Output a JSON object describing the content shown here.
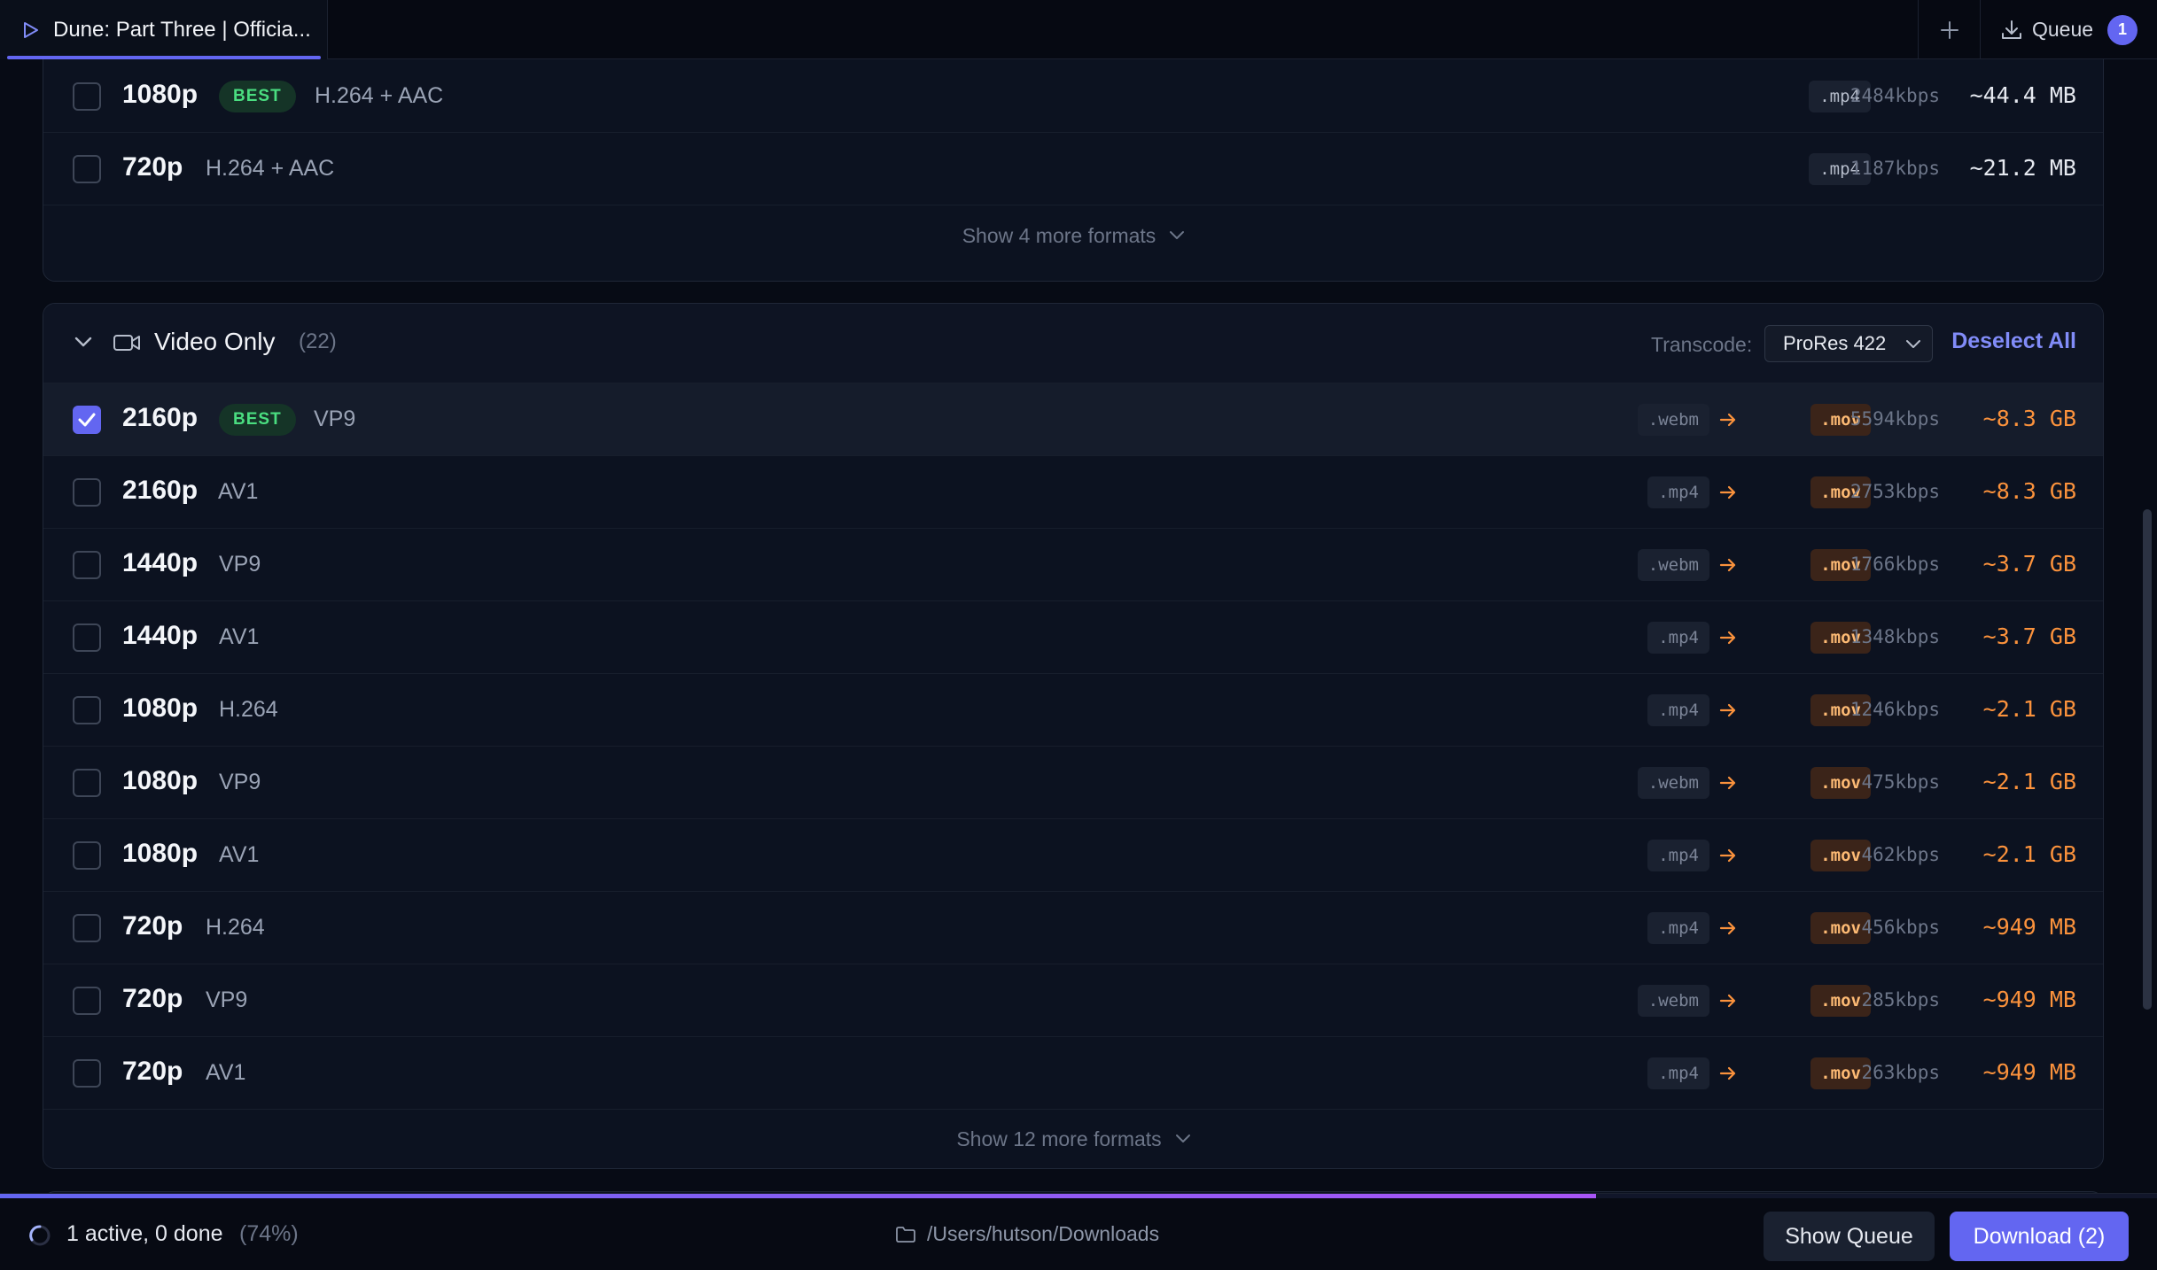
{
  "tab": {
    "title": "Dune: Part Three | Officia..."
  },
  "topbar": {
    "queue_label": "Queue",
    "queue_count": "1"
  },
  "top_group": {
    "rows": [
      {
        "res": "1080p",
        "badge": "BEST",
        "codec": "H.264 + AAC",
        "ext": ".mp4",
        "kbps": "2484kbps",
        "size": "~44.4 MB"
      },
      {
        "res": "720p",
        "badge": "",
        "codec": "H.264 + AAC",
        "ext": ".mp4",
        "kbps": "1187kbps",
        "size": "~21.2 MB"
      }
    ],
    "more_label": "Show 4 more formats"
  },
  "video_only": {
    "title": "Video Only",
    "count": "(22)",
    "transcode_label": "Transcode:",
    "transcode_value": "ProRes 422",
    "deselect_label": "Deselect All",
    "rows": [
      {
        "res": "2160p",
        "badge": "BEST",
        "codec": "VP9",
        "src": ".webm",
        "dst": ".mov",
        "kbps": "5594kbps",
        "size": "~8.3 GB",
        "checked": true
      },
      {
        "res": "2160p",
        "badge": "",
        "codec": "AV1",
        "src": ".mp4",
        "dst": ".mov",
        "kbps": "2753kbps",
        "size": "~8.3 GB",
        "checked": false
      },
      {
        "res": "1440p",
        "badge": "",
        "codec": "VP9",
        "src": ".webm",
        "dst": ".mov",
        "kbps": "1766kbps",
        "size": "~3.7 GB",
        "checked": false
      },
      {
        "res": "1440p",
        "badge": "",
        "codec": "AV1",
        "src": ".mp4",
        "dst": ".mov",
        "kbps": "1348kbps",
        "size": "~3.7 GB",
        "checked": false
      },
      {
        "res": "1080p",
        "badge": "",
        "codec": "H.264",
        "src": ".mp4",
        "dst": ".mov",
        "kbps": "1246kbps",
        "size": "~2.1 GB",
        "checked": false
      },
      {
        "res": "1080p",
        "badge": "",
        "codec": "VP9",
        "src": ".webm",
        "dst": ".mov",
        "kbps": "475kbps",
        "size": "~2.1 GB",
        "checked": false
      },
      {
        "res": "1080p",
        "badge": "",
        "codec": "AV1",
        "src": ".mp4",
        "dst": ".mov",
        "kbps": "462kbps",
        "size": "~2.1 GB",
        "checked": false
      },
      {
        "res": "720p",
        "badge": "",
        "codec": "H.264",
        "src": ".mp4",
        "dst": ".mov",
        "kbps": "456kbps",
        "size": "~949 MB",
        "checked": false
      },
      {
        "res": "720p",
        "badge": "",
        "codec": "VP9",
        "src": ".webm",
        "dst": ".mov",
        "kbps": "285kbps",
        "size": "~949 MB",
        "checked": false
      },
      {
        "res": "720p",
        "badge": "",
        "codec": "AV1",
        "src": ".mp4",
        "dst": ".mov",
        "kbps": "263kbps",
        "size": "~949 MB",
        "checked": false
      }
    ],
    "more_label": "Show 12 more formats"
  },
  "bottombar": {
    "status": "1 active, 0 done",
    "percent": "(74%)",
    "progress": 0.74,
    "path": "/Users/hutson/Downloads",
    "show_queue_label": "Show Queue",
    "download_label": "Download (2)"
  },
  "colors": {
    "accent": "#6366f1",
    "best": "#4ade80",
    "transcode": "#fb923c"
  },
  "icons": [
    "play-icon",
    "plus-icon",
    "download-icon",
    "chevron-down-icon",
    "video-camera-icon",
    "arrow-right-icon",
    "check-icon",
    "spinner-icon",
    "folder-icon"
  ]
}
